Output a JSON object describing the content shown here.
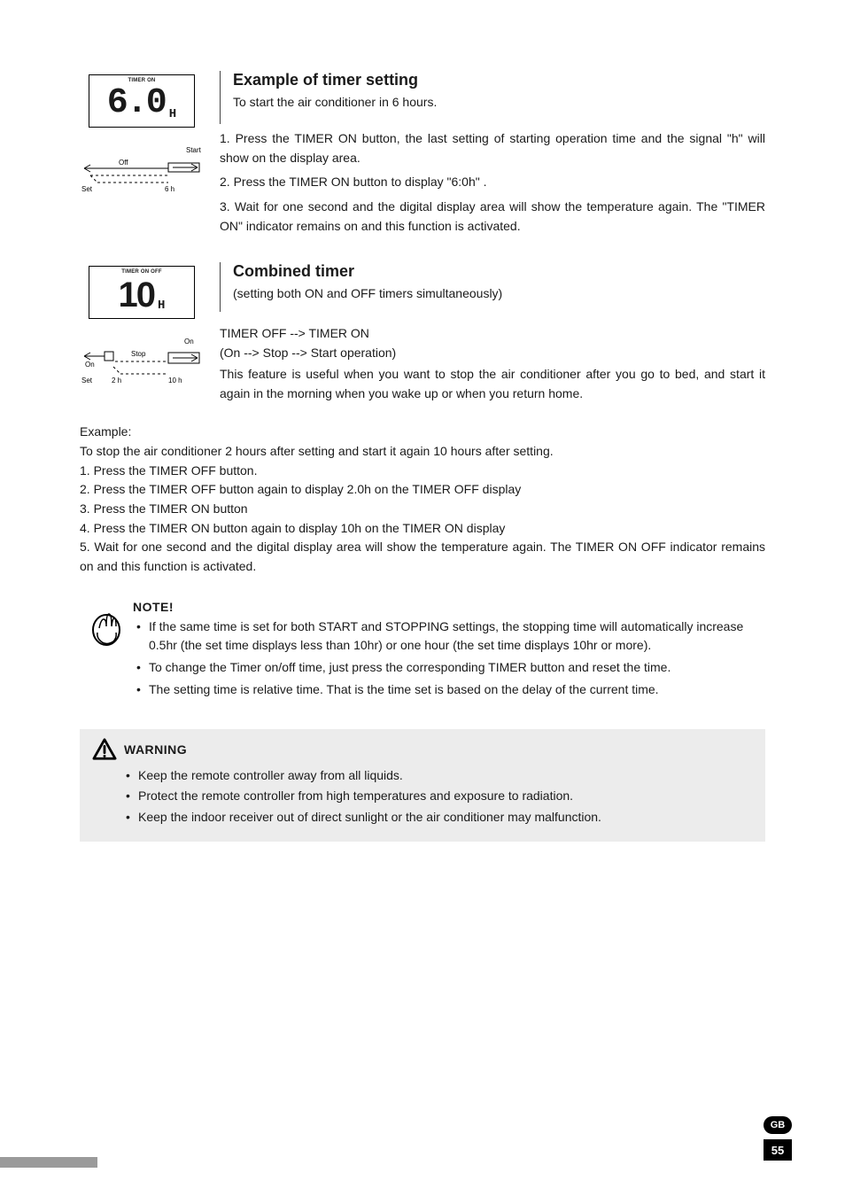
{
  "section1": {
    "lcd_label": "TIMER ON",
    "lcd_digits": "6.0",
    "lcd_suffix": "H",
    "timeline": {
      "top_label": "Start",
      "mid_label": "Off",
      "bl_label": "Set",
      "br_label": "6 h"
    },
    "heading": "Example of timer setting",
    "subhead": "To start the air conditioner in 6 hours.",
    "steps": [
      "1. Press the TIMER ON button, the last setting of starting operation time and the signal \"h\" will show on the display area.",
      "2. Press the TIMER ON button to display \"6:0h\" .",
      "3. Wait for one second and the digital display area will show the temperature again. The \"TIMER ON\" indicator remains on and this function is activated."
    ]
  },
  "section2": {
    "lcd_label": "TIMER ON OFF",
    "lcd_digits": "10",
    "lcd_suffix": "H",
    "timeline": {
      "top_label": "On",
      "mid_label": "Stop",
      "left_label": "On",
      "bl_label": "Set",
      "bm_label": "2 h",
      "br_label": "10 h"
    },
    "heading": "Combined timer",
    "subhead": "(setting both ON and OFF timers simultaneously)",
    "inline_head": "TIMER OFF --> TIMER ON",
    "inline_sub": "(On --> Stop --> Start operation)",
    "inline_body": "This feature is useful when you want to stop the air conditioner after you go to bed, and start it again in the morning when you wake up or when you return home."
  },
  "example2": {
    "title": "Example:",
    "lead": "To stop the air conditioner 2 hours after setting and start it again 10 hours after setting.",
    "steps": [
      "1. Press the TIMER OFF button.",
      "2. Press the TIMER OFF button again to display 2.0h on the TIMER OFF display",
      "3. Press the TIMER ON button",
      "4. Press the TIMER ON button again to display 10h on the TIMER ON display",
      "5. Wait for one second and the digital display area will show the temperature again. The TIMER ON OFF indicator remains on and this function is activated."
    ]
  },
  "note": {
    "title": "NOTE!",
    "items": [
      "If the same time is set for both START and STOPPING settings, the stopping time will automatically increase 0.5hr (the set time displays less than 10hr) or one hour (the set time displays 10hr or more).",
      "To change the Timer on/off time, just press the corresponding TIMER button and reset the time.",
      "The setting time is relative time. That is the time set is based on the delay of the current time."
    ]
  },
  "warning": {
    "title": "WARNING",
    "items": [
      "Keep the remote controller away from all liquids.",
      "Protect the remote controller from high temperatures and exposure to radiation.",
      "Keep the indoor receiver out of direct sunlight or the air conditioner may malfunction."
    ]
  },
  "footer": {
    "lang": "GB",
    "page": "55"
  }
}
